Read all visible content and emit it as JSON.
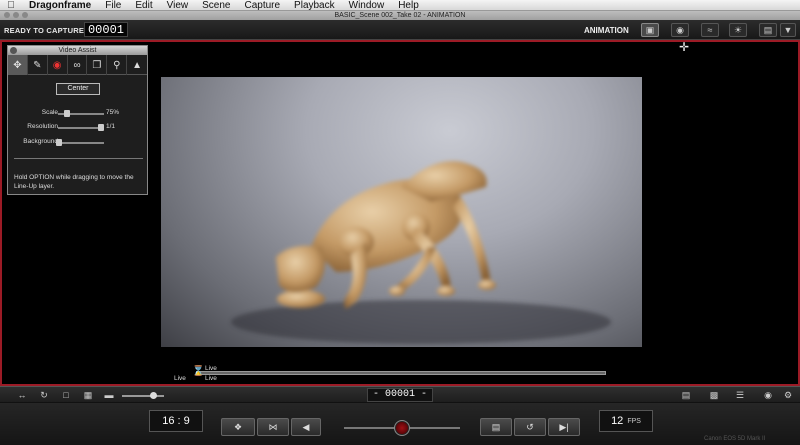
{
  "menubar": {
    "apple_icon": "apple-icon",
    "app_name": "Dragonframe",
    "items": [
      "File",
      "Edit",
      "View",
      "Scene",
      "Capture",
      "Playback",
      "Window",
      "Help"
    ]
  },
  "window": {
    "title": "BASIC_Scene 002_Take 02 - ANIMATION"
  },
  "toolbar": {
    "ready_label": "READY TO CAPTURE:",
    "frame_count": "00001",
    "mode": "ANIMATION",
    "icons": [
      "monitor-icon",
      "camera-icon",
      "audio-icon",
      "lights-icon",
      "menu-dropdown-icon"
    ]
  },
  "video_assist": {
    "title": "Video Assist",
    "tools": [
      "move-icon",
      "pencil-icon",
      "onion-skin-icon",
      "brush-icon",
      "layers-icon",
      "magnifier-icon",
      "levels-icon"
    ],
    "center_label": "Center",
    "scale_label": "Scale",
    "scale_value": "75%",
    "scale_fraction": 0.75,
    "resolution_label": "Resolution",
    "resolution_value": "1/1",
    "resolution_fraction": 1.0,
    "background_label": "Background",
    "background_fraction": 0.0,
    "help_text": "Hold OPTION while dragging to move the Line-Up layer."
  },
  "timeline": {
    "live_top": "Live",
    "live_bottom": "Live",
    "live_left": "Live"
  },
  "strip": {
    "frame_display": "- 00001 -",
    "left_icons": [
      "swap-icon",
      "rotate-icon",
      "safe-area-icon",
      "grid-icon",
      "aspect-icon"
    ],
    "right_icons": [
      "timeline-view-icon",
      "xsheet-icon",
      "list-view-icon",
      "eye-icon",
      "settings-icon"
    ]
  },
  "controls": {
    "aspect_ratio": "16 : 9",
    "fps_value": "12",
    "fps_label": "FPS",
    "camera_label": "Canon EOS 5D Mark II"
  }
}
